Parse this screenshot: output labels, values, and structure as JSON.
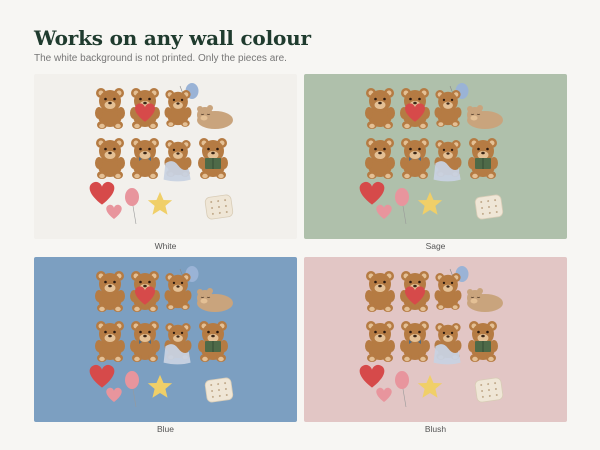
{
  "header": {
    "title": "Works on any wall colour",
    "subtitle": "The white background is not printed. Only the pieces are."
  },
  "panels": [
    {
      "label": "White",
      "color": "#f2f0ec"
    },
    {
      "label": "Sage",
      "color": "#afc0ab"
    },
    {
      "label": "Blue",
      "color": "#7c9fc1"
    },
    {
      "label": "Blush",
      "color": "#e2c6c5"
    }
  ],
  "colors": {
    "bear_fur": "#b57b43",
    "bear_muzzle": "#e4c095",
    "heart": "#d64a4a",
    "balloon_blue": "#9ab3d6",
    "balloon_pink": "#e8959d",
    "star_moon": "#f0cf68",
    "pillow": "#efe6d6",
    "book": "#4e6a48",
    "blanket": "#c8d2e2"
  },
  "pieces": [
    "bear-sitting-icon",
    "bear-hugging-heart-icon",
    "bear-holding-balloon-icon",
    "bear-sleeping-icon",
    "bear-waving-icon",
    "bear-bowtie-icon",
    "bear-blanket-icon",
    "bear-reading-icon",
    "heart-icon",
    "small-heart-icon",
    "pink-balloon-icon",
    "star-icon",
    "moon-icon",
    "pillow-icon"
  ]
}
